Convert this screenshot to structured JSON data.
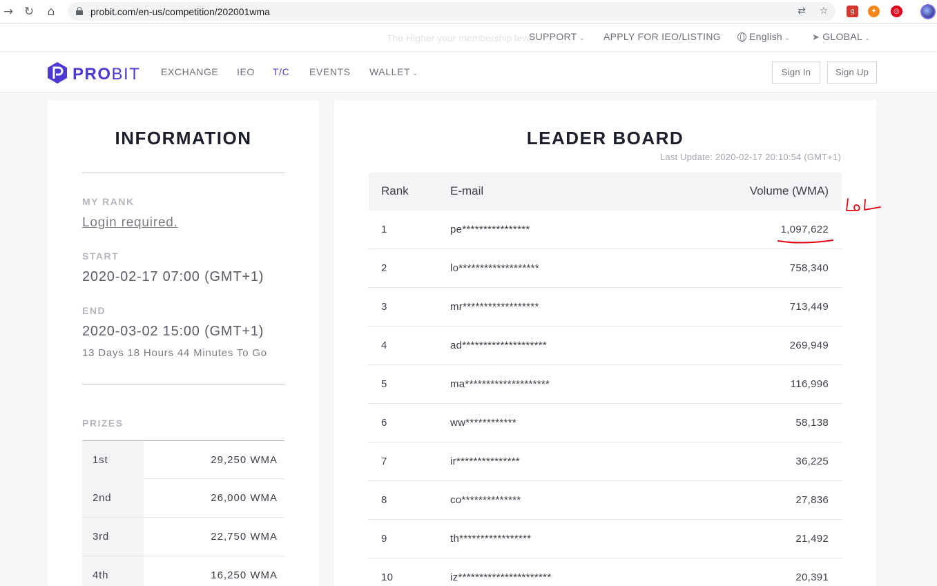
{
  "browser": {
    "url": "probit.com/en-us/competition/202001wma"
  },
  "topbar": {
    "faded_text": "The Higher your membership level",
    "support": "SUPPORT",
    "apply": "APPLY FOR IEO/LISTING",
    "language": "English",
    "region": "GLOBAL"
  },
  "nav": {
    "logo_bold": "PRO",
    "logo_light": "BIT",
    "items": [
      {
        "label": "EXCHANGE"
      },
      {
        "label": "IEO"
      },
      {
        "label": "T/C"
      },
      {
        "label": "EVENTS"
      },
      {
        "label": "WALLET"
      }
    ],
    "active": "T/C",
    "sign_in": "Sign In",
    "sign_up": "Sign Up"
  },
  "colors": {
    "brand": "#4c3ad1",
    "annotation": "#e3000f"
  },
  "info": {
    "title": "INFORMATION",
    "my_rank_label": "MY RANK",
    "my_rank_value": "Login required.",
    "start_label": "START",
    "start_value": "2020-02-17 07:00 (GMT+1)",
    "end_label": "END",
    "end_value": "2020-03-02 15:00 (GMT+1)",
    "countdown": "13 Days 18 Hours 44 Minutes To Go",
    "prizes_label": "PRIZES",
    "prizes": [
      {
        "place": "1st",
        "amount": "29,250 WMA"
      },
      {
        "place": "2nd",
        "amount": "26,000 WMA"
      },
      {
        "place": "3rd",
        "amount": "22,750 WMA"
      },
      {
        "place": "4th",
        "amount": "16,250 WMA"
      }
    ]
  },
  "leaderboard": {
    "title": "LEADER BOARD",
    "last_update": "Last Update: 2020-02-17 20:10:54 (GMT+1)",
    "columns": {
      "rank": "Rank",
      "email": "E-mail",
      "volume": "Volume (WMA)"
    },
    "rows": [
      {
        "rank": "1",
        "email": "pe****************",
        "volume": "1,097,622"
      },
      {
        "rank": "2",
        "email": "lo*******************",
        "volume": "758,340"
      },
      {
        "rank": "3",
        "email": "mr******************",
        "volume": "713,449"
      },
      {
        "rank": "4",
        "email": "ad********************",
        "volume": "269,949"
      },
      {
        "rank": "5",
        "email": "ma********************",
        "volume": "116,996"
      },
      {
        "rank": "6",
        "email": "ww************",
        "volume": "58,138"
      },
      {
        "rank": "7",
        "email": "ir***************",
        "volume": "36,225"
      },
      {
        "rank": "8",
        "email": "co**************",
        "volume": "27,836"
      },
      {
        "rank": "9",
        "email": "th*****************",
        "volume": "21,492"
      },
      {
        "rank": "10",
        "email": "iz**********************",
        "volume": "20,391"
      }
    ]
  },
  "annotation": {
    "handwriting": "lol"
  }
}
